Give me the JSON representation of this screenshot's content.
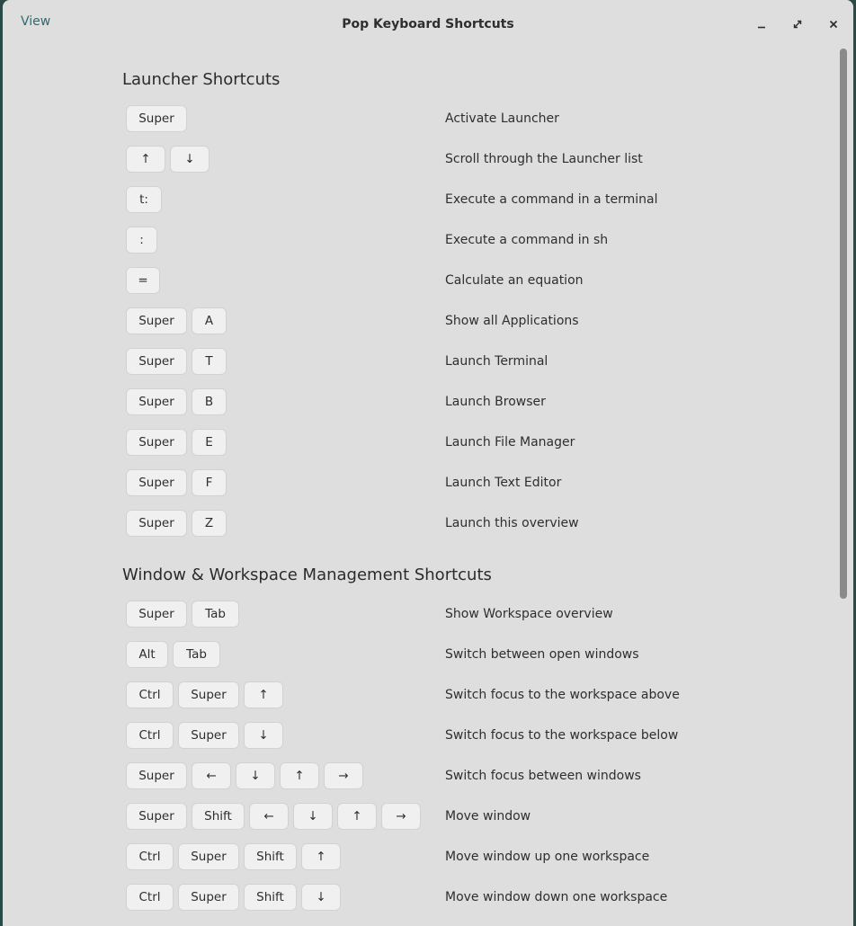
{
  "window": {
    "title": "Pop Keyboard Shortcuts",
    "view_label": "View",
    "icons": {
      "minimize": "minimize-icon",
      "maximize": "maximize-icon",
      "close": "close-icon"
    }
  },
  "sections": [
    {
      "title": "Launcher Shortcuts",
      "rows": [
        {
          "keys": [
            "Super"
          ],
          "desc": "Activate Launcher"
        },
        {
          "keys": [
            "↑",
            "↓"
          ],
          "desc": "Scroll through the Launcher list"
        },
        {
          "keys": [
            "t:"
          ],
          "desc": "Execute a command in a terminal"
        },
        {
          "keys": [
            ":"
          ],
          "desc": "Execute a command in sh"
        },
        {
          "keys": [
            "="
          ],
          "desc": "Calculate an equation"
        },
        {
          "keys": [
            "Super",
            "A"
          ],
          "desc": "Show all Applications"
        },
        {
          "keys": [
            "Super",
            "T"
          ],
          "desc": "Launch Terminal"
        },
        {
          "keys": [
            "Super",
            "B"
          ],
          "desc": "Launch Browser"
        },
        {
          "keys": [
            "Super",
            "E"
          ],
          "desc": "Launch File Manager"
        },
        {
          "keys": [
            "Super",
            "F"
          ],
          "desc": "Launch Text Editor"
        },
        {
          "keys": [
            "Super",
            "Z"
          ],
          "desc": "Launch this overview"
        }
      ]
    },
    {
      "title": "Window & Workspace Management Shortcuts",
      "rows": [
        {
          "keys": [
            "Super",
            "Tab"
          ],
          "desc": "Show Workspace overview"
        },
        {
          "keys": [
            "Alt",
            "Tab"
          ],
          "desc": "Switch between open windows"
        },
        {
          "keys": [
            "Ctrl",
            "Super",
            "↑"
          ],
          "desc": "Switch focus to the workspace above"
        },
        {
          "keys": [
            "Ctrl",
            "Super",
            "↓"
          ],
          "desc": "Switch focus to the workspace below"
        },
        {
          "keys": [
            "Super",
            "←",
            "↓",
            "↑",
            "→"
          ],
          "desc": "Switch focus between windows"
        },
        {
          "keys": [
            "Super",
            "Shift",
            "←",
            "↓",
            "↑",
            "→"
          ],
          "desc": "Move window"
        },
        {
          "keys": [
            "Ctrl",
            "Super",
            "Shift",
            "↑"
          ],
          "desc": "Move window up one workspace"
        },
        {
          "keys": [
            "Ctrl",
            "Super",
            "Shift",
            "↓"
          ],
          "desc": "Move window down one workspace"
        }
      ]
    }
  ]
}
